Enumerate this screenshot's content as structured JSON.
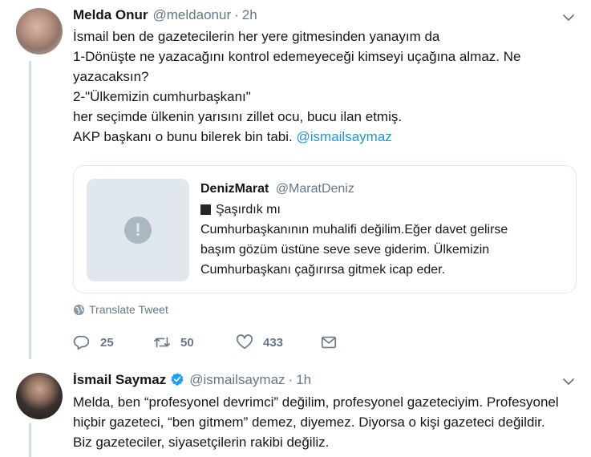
{
  "tweet1": {
    "name": "Melda Onur",
    "handle": "@meldaonur",
    "separator": "·",
    "time": "2h",
    "lines": [
      "İsmail ben de gazetecilerin her yere gitmesinden yanayım da",
      "1-Dönüşte ne yazacağını kontrol edemeyeceği kimseyi uçağına almaz. Ne",
      "yazacaksın?",
      "2-\"Ülkemizin cumhurbaşkanı\"",
      "her seçimde ülkenin yarısını zillet ocu, bucu ilan etmiş.",
      "AKP başkanı o bunu bilerek bin tabi."
    ],
    "mention": "@ismailsaymaz",
    "quote": {
      "name": "DenizMarat",
      "handle": "@MaratDeniz",
      "subtitle": "Şaşırdık mı",
      "lines": [
        "Cumhurbaşkanının muhalifi değilim.Eğer davet gelirse",
        "başım gözüm üstüne seve seve giderim. Ülkemizin",
        "Cumhurbaşkanı çağırırsa gitmek icap eder."
      ]
    },
    "translate_label": "Translate Tweet",
    "actions": {
      "replies": "25",
      "retweets": "50",
      "likes": "433"
    }
  },
  "tweet2": {
    "name": "İsmail Saymaz",
    "handle": "@ismailsaymaz",
    "separator": "·",
    "time": "1h",
    "lines": [
      "Melda, ben “profesyonel devrimci” değilim, profesyonel gazeteciyim. Profesyonel",
      "hiçbir gazeteci, “ben gitmem” demez, diyemez. Diyorsa o kişi gazeteci değildir.",
      "Biz gazeteciler, siyasetçilerin rakibi değiliz."
    ]
  },
  "colors": {
    "link": "#1b95e0",
    "muted": "#657786",
    "thread": "#cce1ef",
    "border": "#e1e8ed"
  }
}
